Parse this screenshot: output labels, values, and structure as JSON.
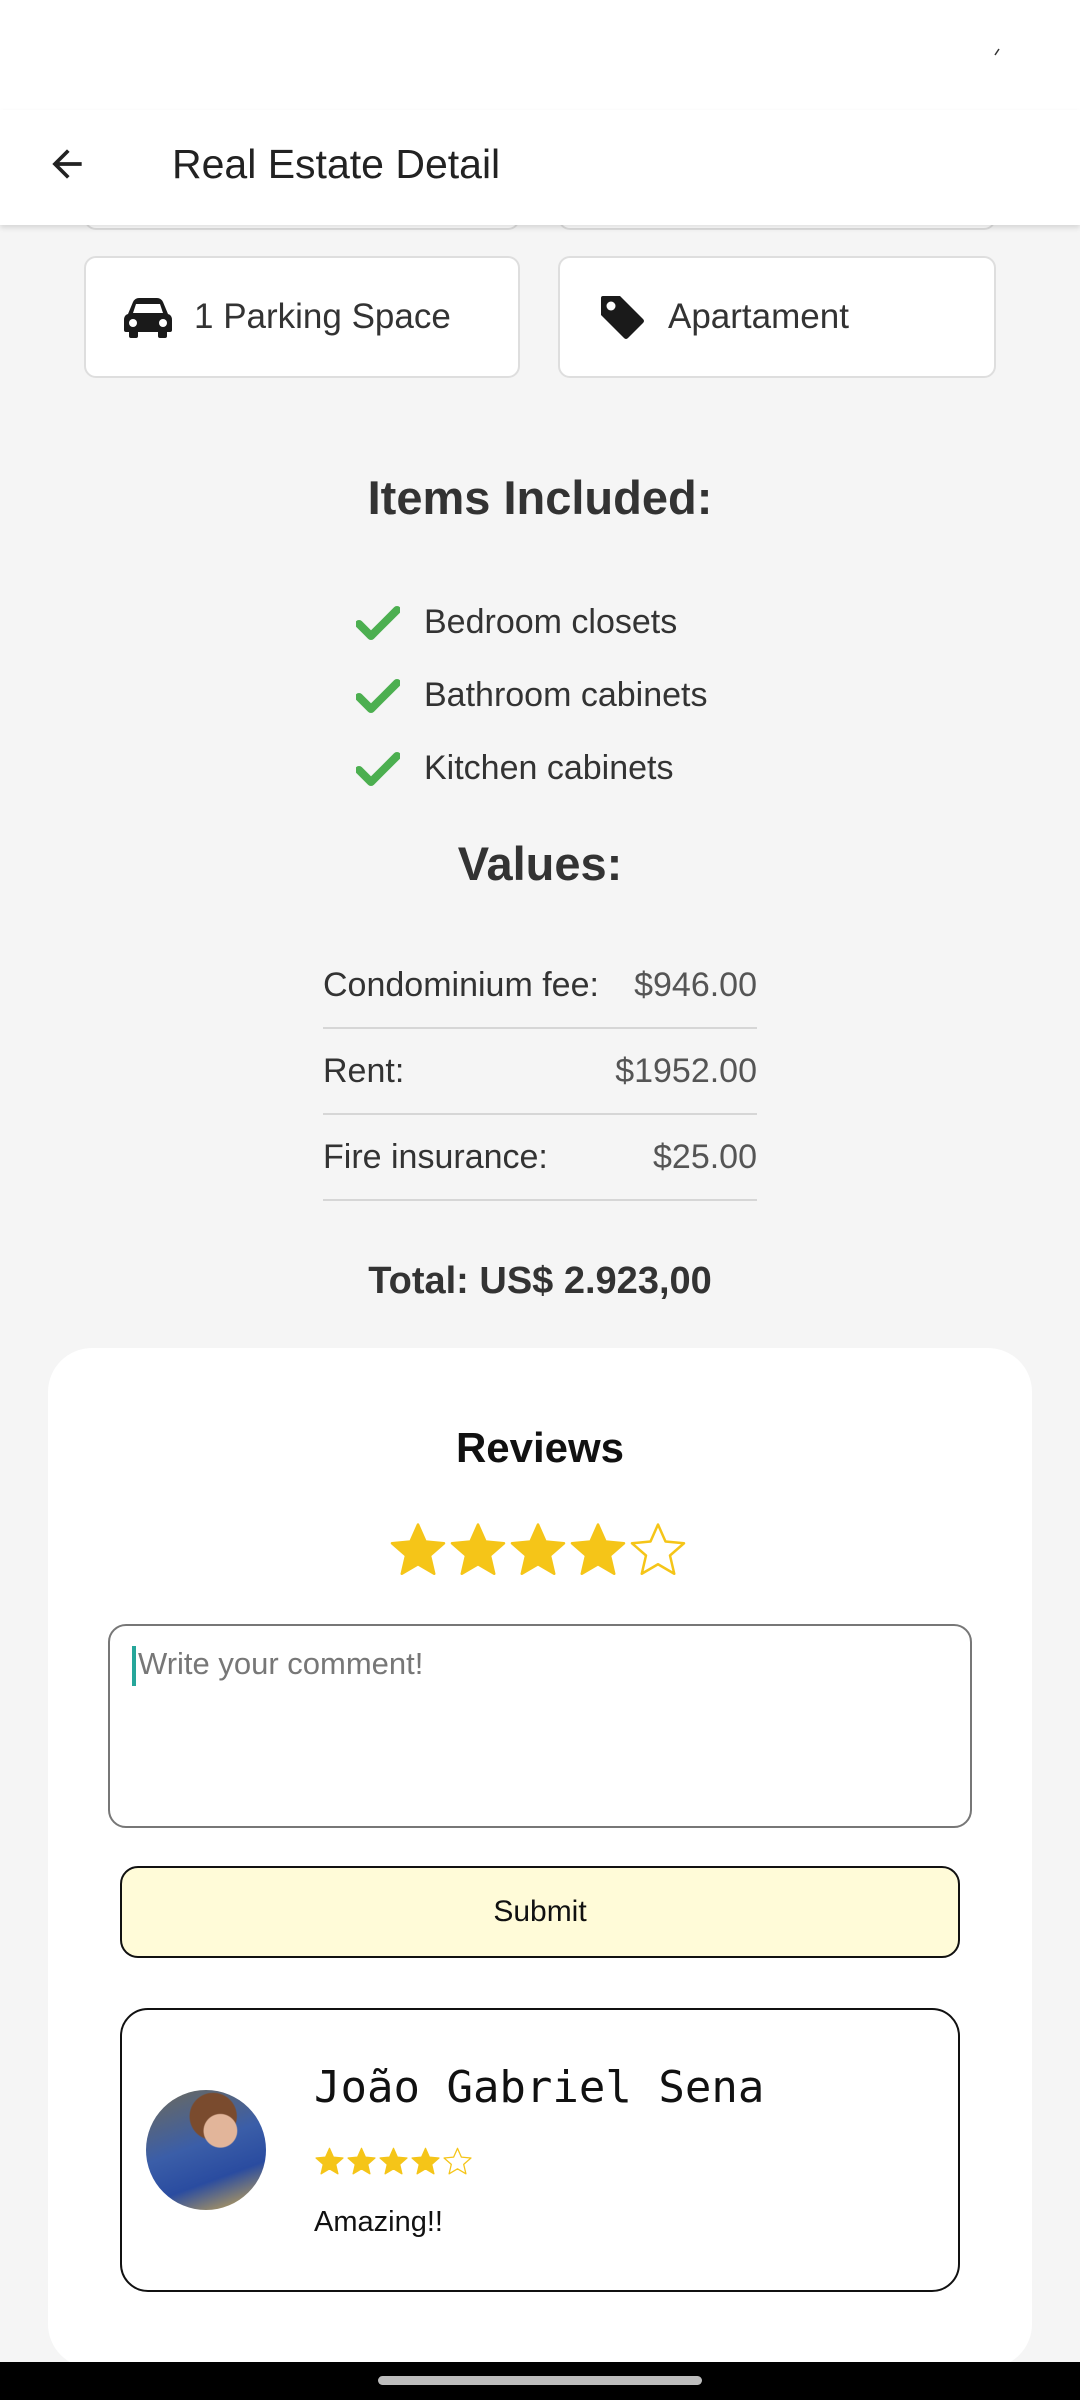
{
  "app_bar": {
    "title": "Real Estate Detail",
    "back_icon": "arrow-left-icon"
  },
  "features": [
    {
      "label": "1 Parking Space",
      "icon": "car-icon"
    },
    {
      "label": "Apartament",
      "icon": "tag-icon"
    }
  ],
  "included": {
    "title": "Items Included:",
    "items": [
      "Bedroom closets",
      "Bathroom cabinets",
      "Kitchen cabinets"
    ],
    "check_color": "#4caf50"
  },
  "values": {
    "title": "Values:",
    "rows": [
      {
        "label": "Condominium fee:",
        "amount": "$946.00"
      },
      {
        "label": "Rent:",
        "amount": "$1952.00"
      },
      {
        "label": "Fire insurance:",
        "amount": "$25.00"
      }
    ],
    "total": "Total: US$ 2.923,00"
  },
  "reviews": {
    "title": "Reviews",
    "rating": 4,
    "max_rating": 5,
    "star_color": "#f5c518",
    "comment_placeholder": "Write your comment!",
    "submit_label": "Submit",
    "items": [
      {
        "name": "João Gabriel Sena",
        "rating": 4,
        "text": "Amazing!!"
      }
    ]
  }
}
